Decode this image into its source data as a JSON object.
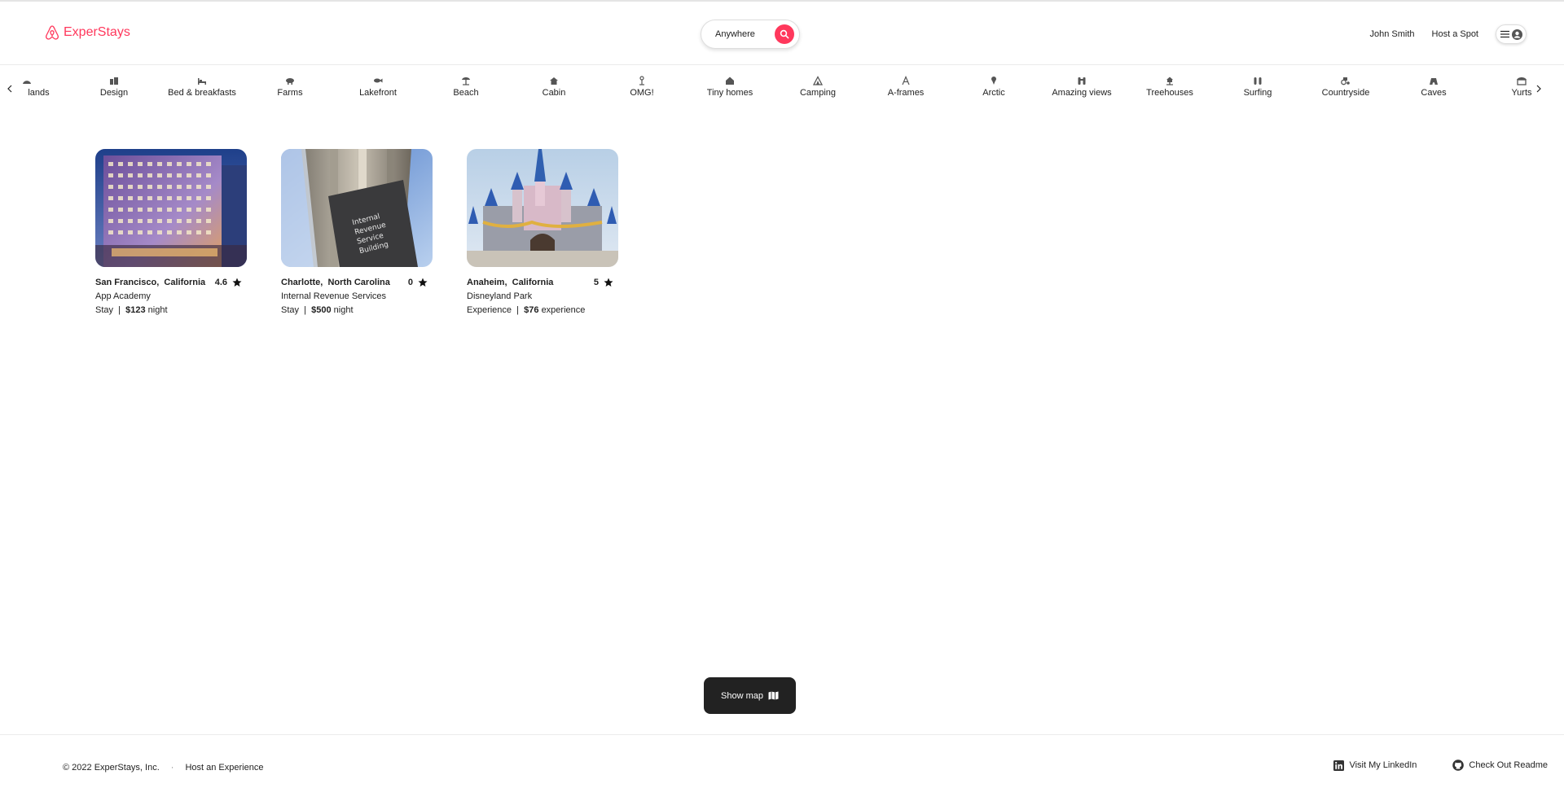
{
  "brand": {
    "name": "ExperStays",
    "color": "#ff385c"
  },
  "header": {
    "search_label": "Anywhere",
    "user_name": "John Smith",
    "host_link": "Host a Spot"
  },
  "categories": [
    {
      "label": "lands",
      "icon": "island-icon"
    },
    {
      "label": "Design",
      "icon": "design-icon"
    },
    {
      "label": "Bed & breakfasts",
      "icon": "bed-icon"
    },
    {
      "label": "Farms",
      "icon": "farm-icon"
    },
    {
      "label": "Lakefront",
      "icon": "fish-icon"
    },
    {
      "label": "Beach",
      "icon": "umbrella-icon"
    },
    {
      "label": "Cabin",
      "icon": "cabin-icon"
    },
    {
      "label": "OMG!",
      "icon": "omg-icon"
    },
    {
      "label": "Tiny homes",
      "icon": "tiny-home-icon"
    },
    {
      "label": "Camping",
      "icon": "tent-icon"
    },
    {
      "label": "A-frames",
      "icon": "a-frame-icon"
    },
    {
      "label": "Arctic",
      "icon": "ice-cream-icon"
    },
    {
      "label": "Amazing views",
      "icon": "binoculars-icon"
    },
    {
      "label": "Treehouses",
      "icon": "treehouse-icon"
    },
    {
      "label": "Surfing",
      "icon": "surfing-icon"
    },
    {
      "label": "Countryside",
      "icon": "tractor-icon"
    },
    {
      "label": "Caves",
      "icon": "cave-icon"
    },
    {
      "label": "Yurts",
      "icon": "yurt-icon"
    }
  ],
  "listings": [
    {
      "city": "San Francisco,",
      "state": "California",
      "rating": "4.6",
      "name": "App Academy",
      "type": "Stay",
      "price": "$123",
      "unit": "night",
      "image": "city-building-photo"
    },
    {
      "city": "Charlotte,",
      "state": "North Carolina",
      "rating": "0",
      "name": "Internal Revenue Services",
      "type": "Stay",
      "price": "$500",
      "unit": "night",
      "image": "irs-building-photo"
    },
    {
      "city": "Anaheim,",
      "state": "California",
      "rating": "5",
      "name": "Disneyland Park",
      "type": "Experience",
      "price": "$76",
      "unit": "experience",
      "image": "castle-photo"
    }
  ],
  "show_map_label": "Show map",
  "footer": {
    "copyright": "© 2022 ExperStays, Inc.",
    "separator": "·",
    "host_experience": "Host an Experience",
    "linkedin": "Visit My LinkedIn",
    "readme": "Check Out Readme"
  }
}
